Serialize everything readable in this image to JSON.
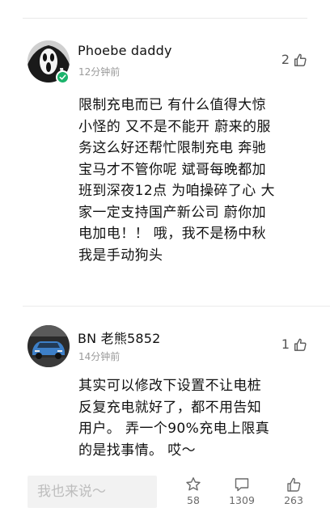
{
  "comments": [
    {
      "username": "Phoebe daddy",
      "time": "12分钟前",
      "likes": "2",
      "lines": [
        "限制充电而已 有什么值得大惊",
        "小怪的 又不是不能开 蔚来的服",
        "务这么好还帮忙限制充电 奔驰",
        "宝马才不管你呢 斌哥每晚都加",
        "班到深夜12点 为咱操碎了心 大",
        "家一定支持国产新公司 蔚你加",
        "电加电！！ 哦，我不是杨中秋",
        "我是手动狗头"
      ],
      "avatar_icon": "scream-mask-icon",
      "verified_color": "#1bb36b"
    },
    {
      "username": "BN 老熊5852",
      "time": "14分钟前",
      "likes": "1",
      "lines": [
        "其实可以修改下设置不让电桩",
        "反复充电就好了，都不用告知",
        "用户。 弄一个90%充电上限真",
        "的是找事情。 哎～"
      ],
      "avatar_icon": "blue-car-icon"
    }
  ],
  "bottom_bar": {
    "reply_placeholder": "我也来说～",
    "favorites_count": "58",
    "comments_count": "1309",
    "likes_count": "263"
  }
}
